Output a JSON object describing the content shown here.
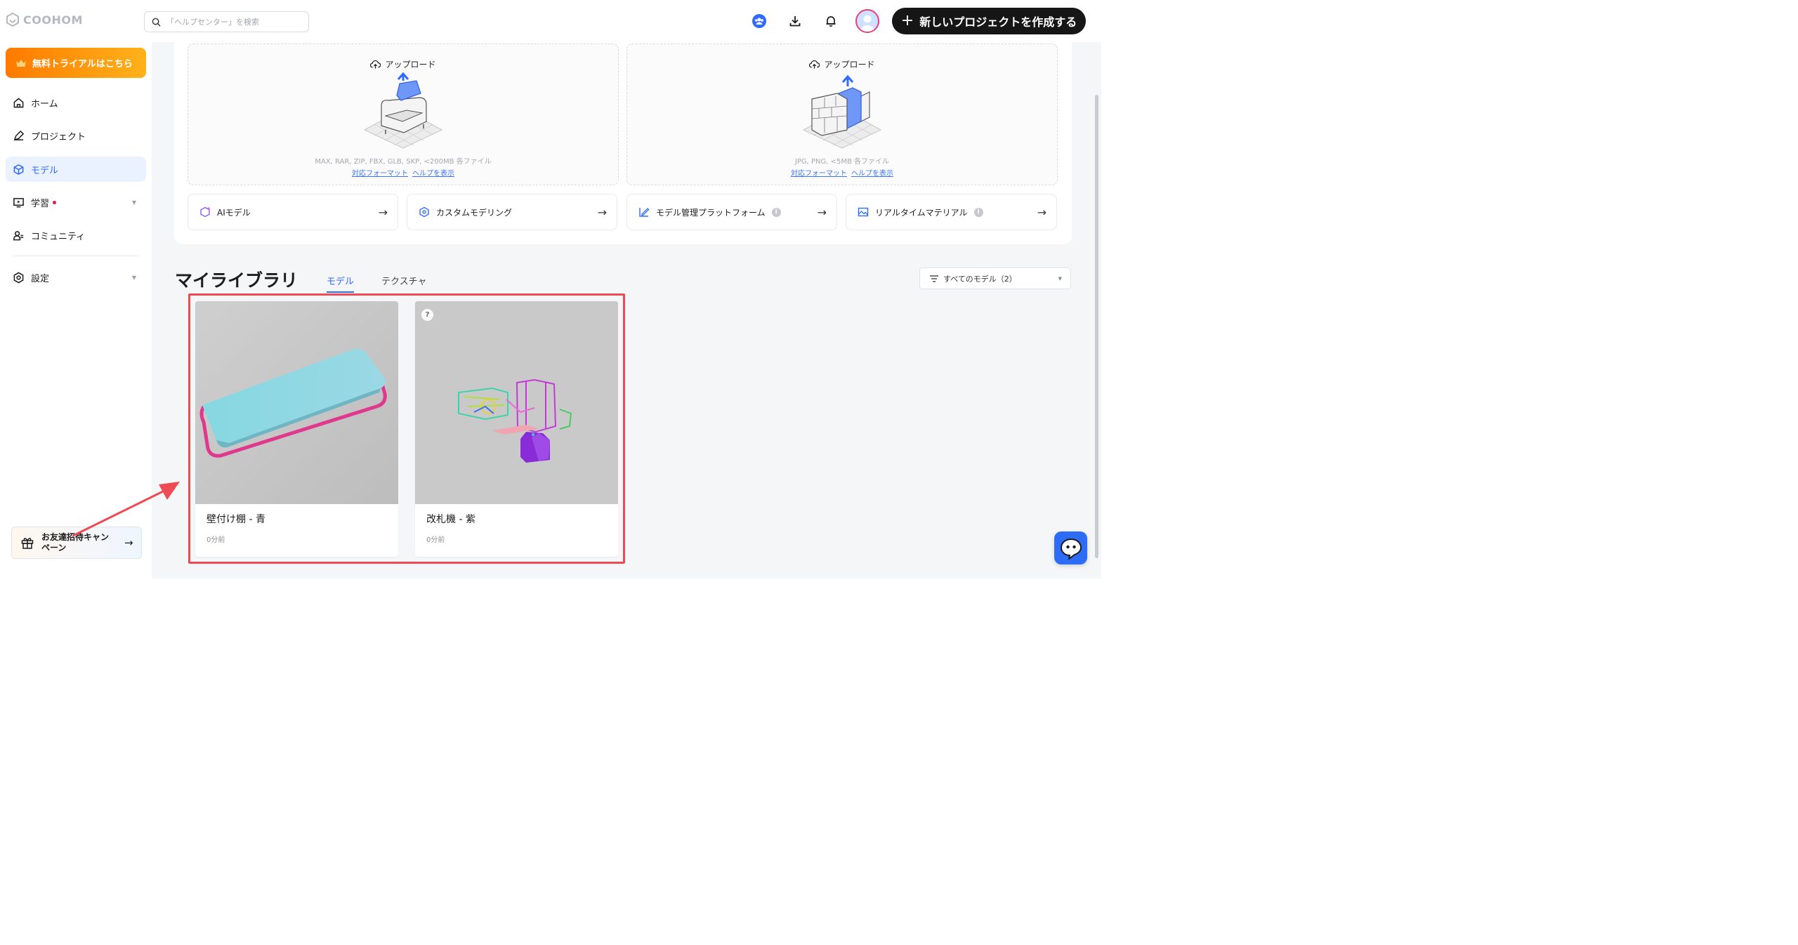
{
  "app": {
    "logo_text": "COOHOM"
  },
  "search": {
    "placeholder": "「ヘルプセンター」を検索"
  },
  "header": {
    "new_project_label": "新しいプロジェクトを作成する"
  },
  "sidebar": {
    "trial_label": "無料トライアルはこちら",
    "items": [
      {
        "label": "ホーム"
      },
      {
        "label": "プロジェクト"
      },
      {
        "label": "モデル",
        "active": true
      },
      {
        "label": "学習"
      },
      {
        "label": "コミュニティ"
      },
      {
        "label": "設定"
      }
    ],
    "invite_label": "お友達招待キャンペーン"
  },
  "upload": {
    "left": {
      "title": "アップロード",
      "formats": "MAX, RAR, ZIP, FBX, GLB, SKP, <200MB 各ファイル",
      "link_formats": "対応フォーマット",
      "link_help": "ヘルプを表示"
    },
    "right": {
      "title": "アップロード",
      "formats": "JPG, PNG, <5MB 各ファイル",
      "link_formats": "対応フォーマット",
      "link_help": "ヘルプを表示"
    }
  },
  "features": [
    {
      "label": "AIモデル"
    },
    {
      "label": "カスタムモデリング"
    },
    {
      "label": "モデル管理プラットフォーム"
    },
    {
      "label": "リアルタイムマテリアル"
    }
  ],
  "library": {
    "title": "マイライブラリ",
    "tabs": [
      {
        "label": "モデル",
        "active": true
      },
      {
        "label": "テクスチャ"
      }
    ],
    "filter_label": "すべてのモデル（2）",
    "cards": [
      {
        "name": "壁付け棚 - 青",
        "time": "0分前"
      },
      {
        "name": "改札機 - 紫",
        "time": "0分前"
      }
    ]
  },
  "colors": {
    "accent": "#2f6bff",
    "highlight": "#ef4b55",
    "trial": "#ff8a00",
    "button_dark": "#161616"
  }
}
